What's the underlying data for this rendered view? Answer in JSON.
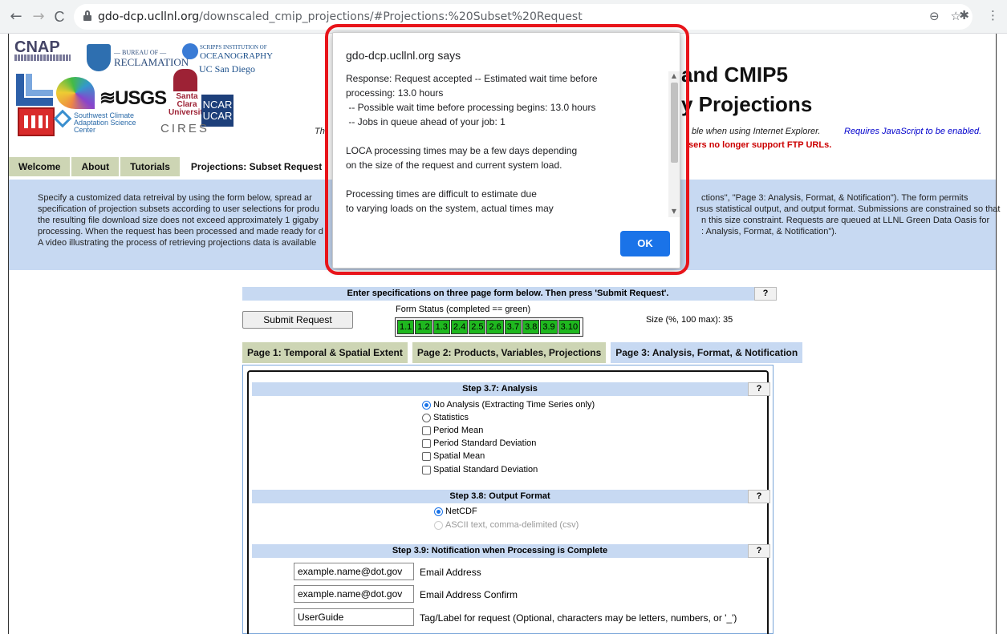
{
  "browser": {
    "back": "←",
    "forward": "→",
    "reload": "C",
    "url_host": "gdo-dcp.ucllnl.org",
    "url_path": "/downscaled_cmip_projections/#Projections:%20Subset%20Request",
    "icons": [
      "zoom-icon",
      "star-icon",
      "extensions-icon",
      "menu-icon"
    ]
  },
  "logos": {
    "cnap": "CNAP",
    "reclamation_top": "— BUREAU OF —",
    "reclamation": "RECLAMATION",
    "scripps_top": "SCRIPPS INSTITUTION OF",
    "scripps": "OCEANOGRAPHY",
    "ucsd": "UC San Diego",
    "usgs": "≋USGS",
    "scu": "Santa Clara University",
    "ncar": "NCAR UCAR",
    "swcasc": "Southwest Climate Adaptation Science Center",
    "cires": "CIRES"
  },
  "header": {
    "title_line1": "and CMIP5",
    "title_line2": "y Projections",
    "note_left": "Thi",
    "note_ie": "ble when using Internet Explorer.",
    "note_js": "Requires JavaScript to be enabled.",
    "note_ftp": "sers no longer support FTP URLs."
  },
  "tabs": [
    "Welcome",
    "About",
    "Tutorials",
    "Projections: Subset Request"
  ],
  "description": {
    "line1_left": "Specify a customized data retreival by using the form below, spread ar",
    "line1_right": "ctions\", \"Page 3: Analysis, Format, & Notification\"). The form permits",
    "line2_left": "specification of projection subsets according to user selections for produ",
    "line2_right": "rsus statistical output, and output format. Submissions are constrained so that",
    "line3_left": "the resulting file download size does not exceed approximately 1 gigaby",
    "line3_right": "n this size constraint. Requests are queued at LLNL Green Data Oasis for",
    "line4_left": "processing. When the request has been processed and made ready for d",
    "line4_right": ": Analysis, Format, & Notification\").",
    "line5_left": "A video illustrating the process of retrieving projections data is available"
  },
  "form": {
    "heading": "Enter specifications on three page form below. Then press 'Submit Request'.",
    "help": "?",
    "submit": "Submit Request",
    "status_label": "Form Status (completed == green)",
    "status_cells": [
      "1.1",
      "1.2",
      "1.3",
      "2.4",
      "2.5",
      "2.6",
      "3.7",
      "3.8",
      "3.9",
      "3.10"
    ],
    "size_label": "Size (%, 100 max): 35",
    "status_color": "#1fb81f"
  },
  "page_tabs": [
    "Page 1: Temporal & Spatial Extent",
    "Page 2: Products, Variables, Projections",
    "Page 3: Analysis, Format, & Notification"
  ],
  "step37": {
    "title": "Step 3.7: Analysis",
    "no_analysis": "No Analysis (Extracting Time Series only)",
    "statistics": "Statistics",
    "period_mean": "Period Mean",
    "period_sd": "Period Standard Deviation",
    "spatial_mean": "Spatial Mean",
    "spatial_sd": "Spatial Standard Deviation"
  },
  "step38": {
    "title": "Step 3.8: Output Format",
    "netcdf": "NetCDF",
    "ascii": "ASCII text, comma-delimited (csv)"
  },
  "step39": {
    "title": "Step 3.9: Notification when Processing is Complete",
    "email_value": "example.name@dot.gov",
    "email_label": "Email Address",
    "email_confirm_value": "example.name@dot.gov",
    "email_confirm_label": "Email Address Confirm",
    "tag_value": "UserGuide",
    "tag_label": "Tag/Label for request (Optional, characters may be letters, numbers, or '_')"
  },
  "dialog": {
    "title": "gdo-dcp.ucllnl.org says",
    "lines": [
      "Response: Request accepted -- Estimated wait time before",
      "processing: 13.0 hours",
      " -- Possible wait time before processing begins: 13.0 hours",
      " -- Jobs in queue ahead of your job: 1",
      "",
      "LOCA processing times may be a few days depending",
      "on the size of the request and current system load.",
      "",
      "Processing times are difficult to estimate due",
      "to varying loads on the system, actual times may"
    ],
    "ok": "OK",
    "highlight_color": "#e8141a"
  }
}
